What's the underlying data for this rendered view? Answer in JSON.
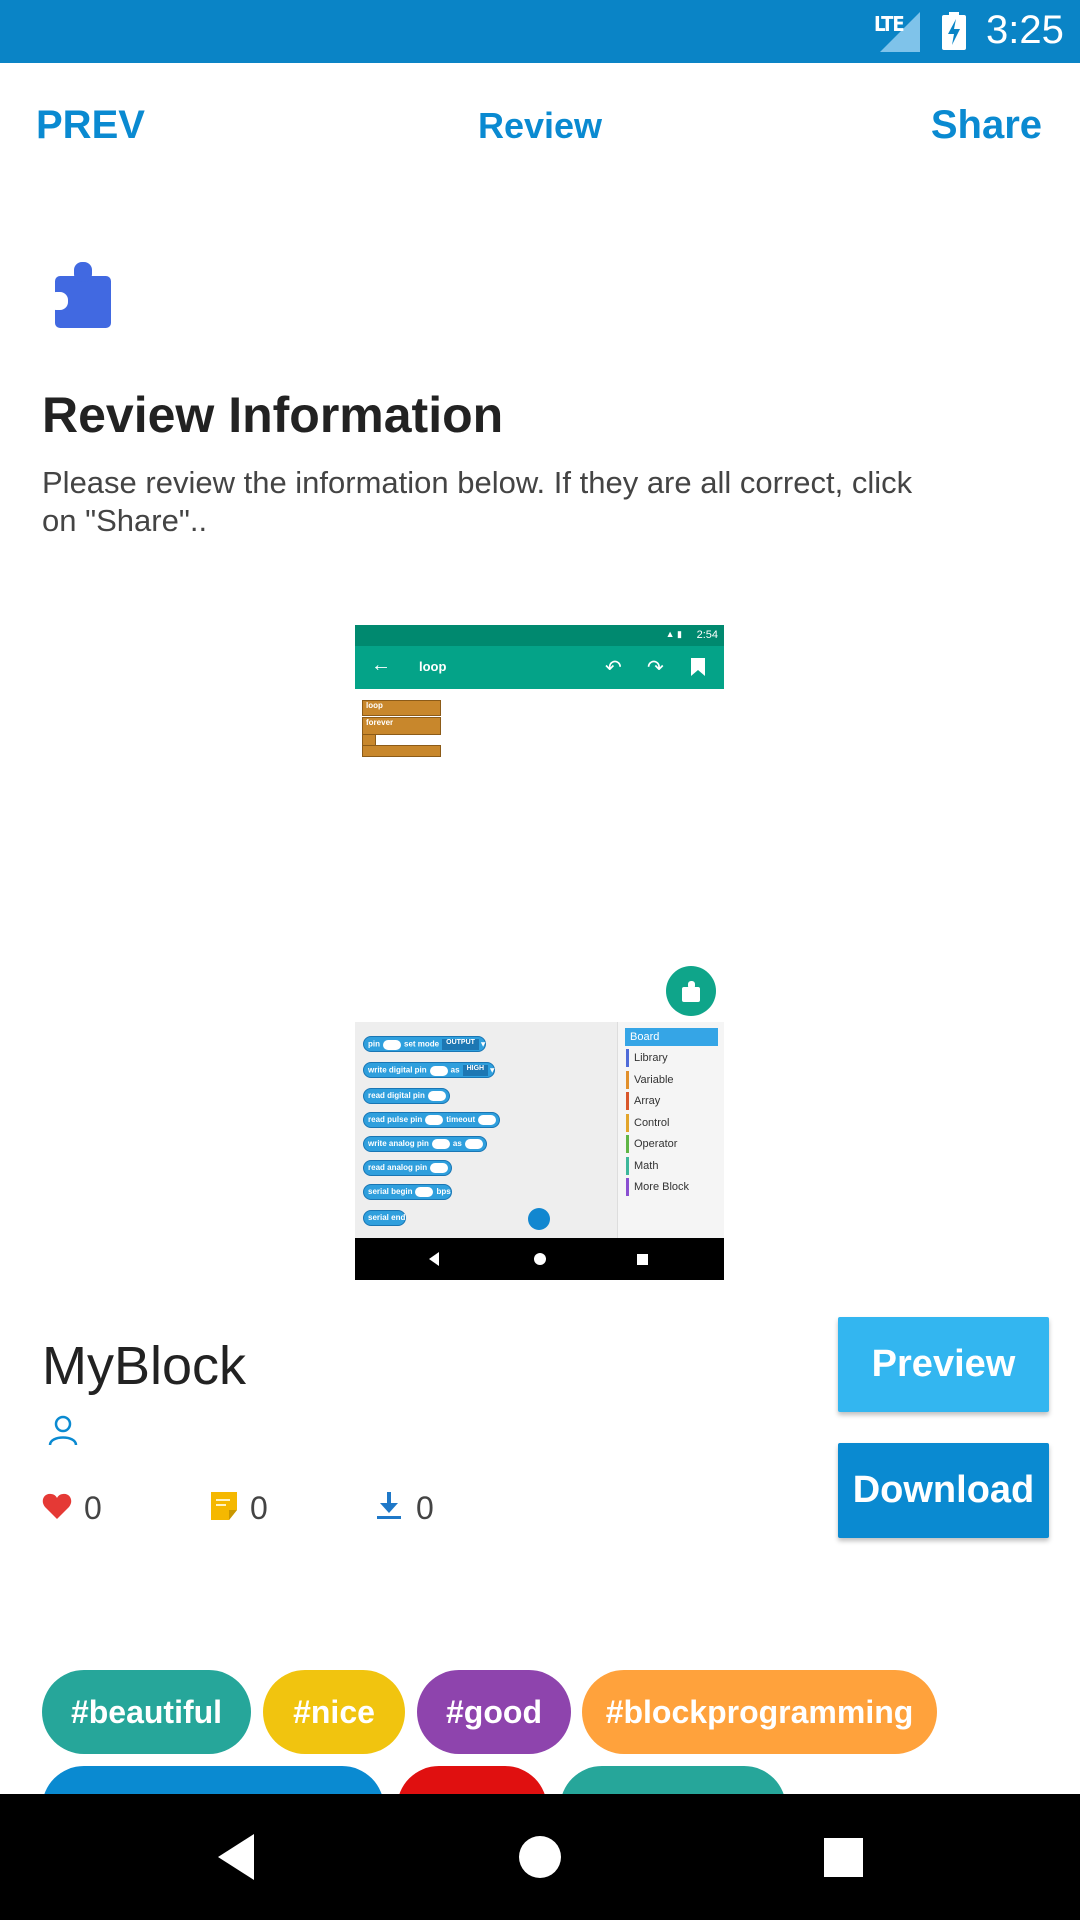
{
  "status_bar": {
    "network": "LTE",
    "time": "3:25"
  },
  "nav": {
    "prev": "PREV",
    "title": "Review",
    "share": "Share"
  },
  "review": {
    "title": "Review Information",
    "description": "Please review the information below. If they are all correct, click on \"Share\".."
  },
  "screenshot": {
    "status_time": "2:54",
    "app_title": "loop",
    "blocks": [
      "loop",
      "forever"
    ],
    "palette": {
      "pin": "pin",
      "set_mode": "set mode",
      "output": "OUTPUT",
      "write_digital_pin": "write digital pin",
      "as": "as",
      "high": "HIGH",
      "read_digital_pin": "read digital pin",
      "read_pulse_pin": "read pulse pin",
      "timeout": "timeout",
      "write_analog_pin": "write analog pin",
      "read_analog_pin": "read analog pin",
      "serial_begin": "serial begin",
      "bps": "bps",
      "serial_end": "serial end"
    },
    "categories": [
      "Board",
      "Library",
      "Variable",
      "Array",
      "Control",
      "Operator",
      "Math",
      "More Block"
    ],
    "category_colors": [
      "#35a5e6",
      "#4f6bd8",
      "#e2902c",
      "#d9572b",
      "#e3a52b",
      "#5fb545",
      "#3db79a",
      "#8a4fd1"
    ]
  },
  "block_info": {
    "name": "MyBlock",
    "likes": "0",
    "comments": "0",
    "downloads": "0"
  },
  "buttons": {
    "preview": "Preview",
    "download": "Download"
  },
  "tags": [
    {
      "label": "#beautiful",
      "color": "#26a69a"
    },
    {
      "label": "#nice",
      "color": "#f1c40f"
    },
    {
      "label": "#good",
      "color": "#8e44ad"
    },
    {
      "label": "#blockprogramming",
      "color": "#ffa23c"
    }
  ],
  "colors": {
    "accent": "#0a8ad1",
    "status_bar": "#0a84c6",
    "preview_button": "#33b6f0"
  }
}
